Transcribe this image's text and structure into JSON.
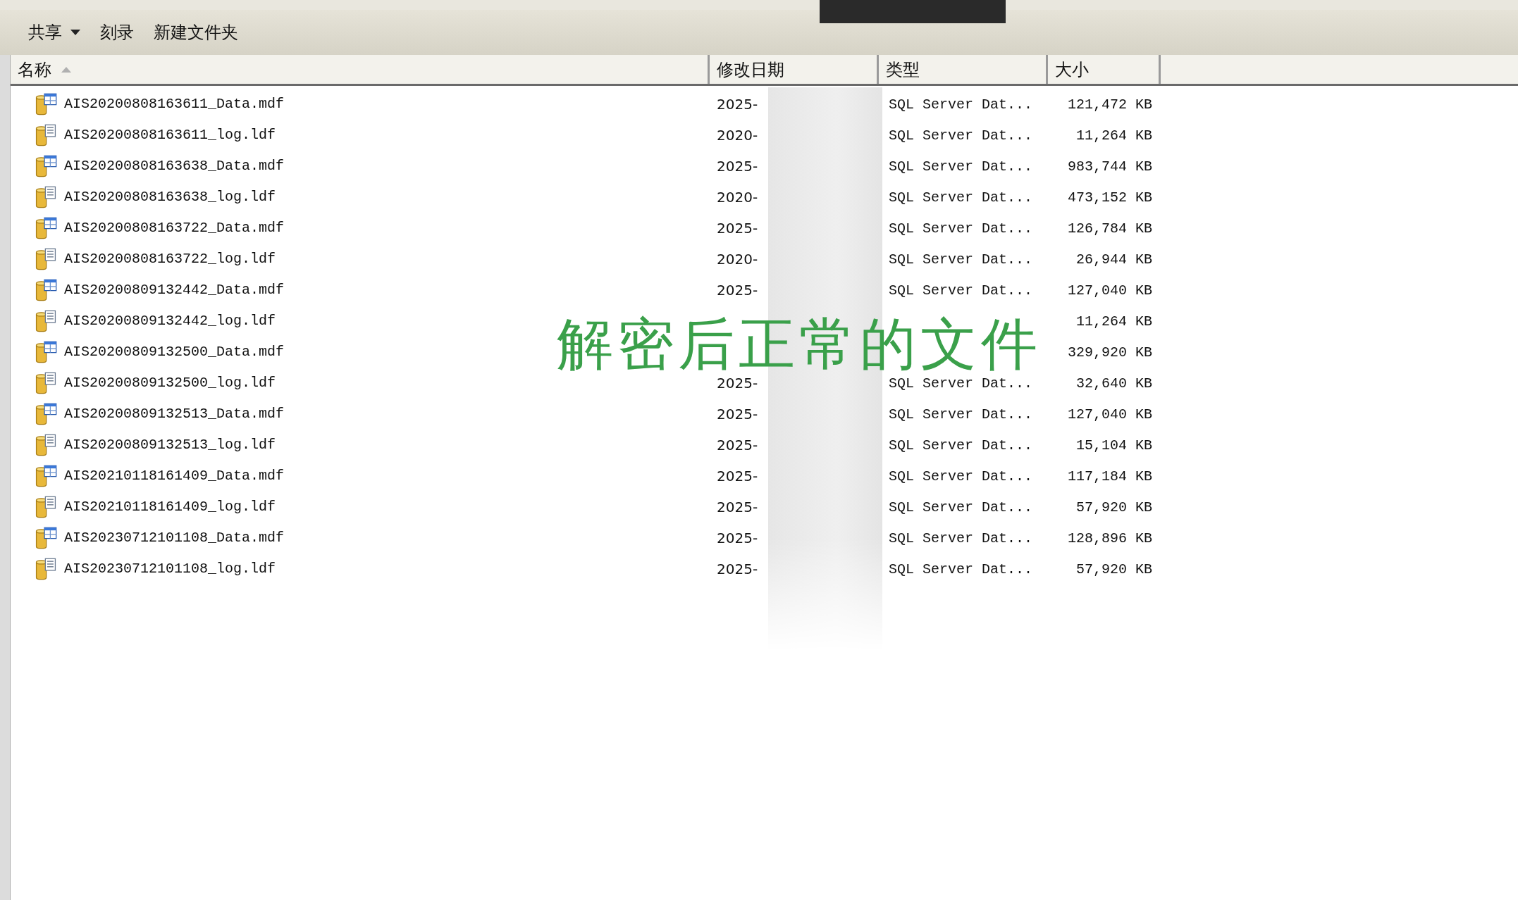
{
  "toolbar": {
    "items": [
      {
        "label": "共享",
        "has_menu": true
      },
      {
        "label": "刻录",
        "has_menu": false
      },
      {
        "label": "新建文件夹",
        "has_menu": false
      }
    ]
  },
  "columns": [
    {
      "label": "名称",
      "sorted": true
    },
    {
      "label": "修改日期",
      "sorted": false
    },
    {
      "label": "类型",
      "sorted": false
    },
    {
      "label": "大小",
      "sorted": false
    }
  ],
  "files": [
    {
      "kind": "data",
      "name": "AIS20200808163611_Data.mdf",
      "date": "2025-",
      "type": "SQL Server Dat...",
      "size": "121,472 KB"
    },
    {
      "kind": "log",
      "name": "AIS20200808163611_log.ldf",
      "date": "2020-",
      "type": "SQL Server Dat...",
      "size": "11,264 KB"
    },
    {
      "kind": "data",
      "name": "AIS20200808163638_Data.mdf",
      "date": "2025-",
      "type": "SQL Server Dat...",
      "size": "983,744 KB"
    },
    {
      "kind": "log",
      "name": "AIS20200808163638_log.ldf",
      "date": "2020-",
      "type": "SQL Server Dat...",
      "size": "473,152 KB"
    },
    {
      "kind": "data",
      "name": "AIS20200808163722_Data.mdf",
      "date": "2025-",
      "type": "SQL Server Dat...",
      "size": "126,784 KB"
    },
    {
      "kind": "log",
      "name": "AIS20200808163722_log.ldf",
      "date": "2020-",
      "type": "SQL Server Dat...",
      "size": "26,944 KB"
    },
    {
      "kind": "data",
      "name": "AIS20200809132442_Data.mdf",
      "date": "2025-",
      "type": "SQL Server Dat...",
      "size": "127,040 KB"
    },
    {
      "kind": "log",
      "name": "AIS20200809132442_log.ldf",
      "size": "11,264 KB"
    },
    {
      "kind": "data",
      "name": "AIS20200809132500_Data.mdf",
      "size": "329,920 KB"
    },
    {
      "kind": "log",
      "name": "AIS20200809132500_log.ldf",
      "date": "2025-",
      "type": "SQL Server Dat...",
      "size": "32,640 KB"
    },
    {
      "kind": "data",
      "name": "AIS20200809132513_Data.mdf",
      "date": "2025-",
      "type": "SQL Server Dat...",
      "size": "127,040 KB"
    },
    {
      "kind": "log",
      "name": "AIS20200809132513_log.ldf",
      "date": "2025-",
      "type": "SQL Server Dat...",
      "size": "15,104 KB"
    },
    {
      "kind": "data",
      "name": "AIS20210118161409_Data.mdf",
      "date": "2025-",
      "type": "SQL Server Dat...",
      "size": "117,184 KB"
    },
    {
      "kind": "log",
      "name": "AIS20210118161409_log.ldf",
      "date": "2025-",
      "type": "SQL Server Dat...",
      "size": "57,920 KB"
    },
    {
      "kind": "data",
      "name": "AIS20230712101108_Data.mdf",
      "date": "2025-",
      "type": "SQL Server Dat...",
      "size": "128,896 KB"
    },
    {
      "kind": "log",
      "name": "AIS20230712101108_log.ldf",
      "date": "2025-",
      "type": "SQL Server Dat...",
      "size": "57,920 KB"
    }
  ],
  "caption": "解密后正常的文件"
}
